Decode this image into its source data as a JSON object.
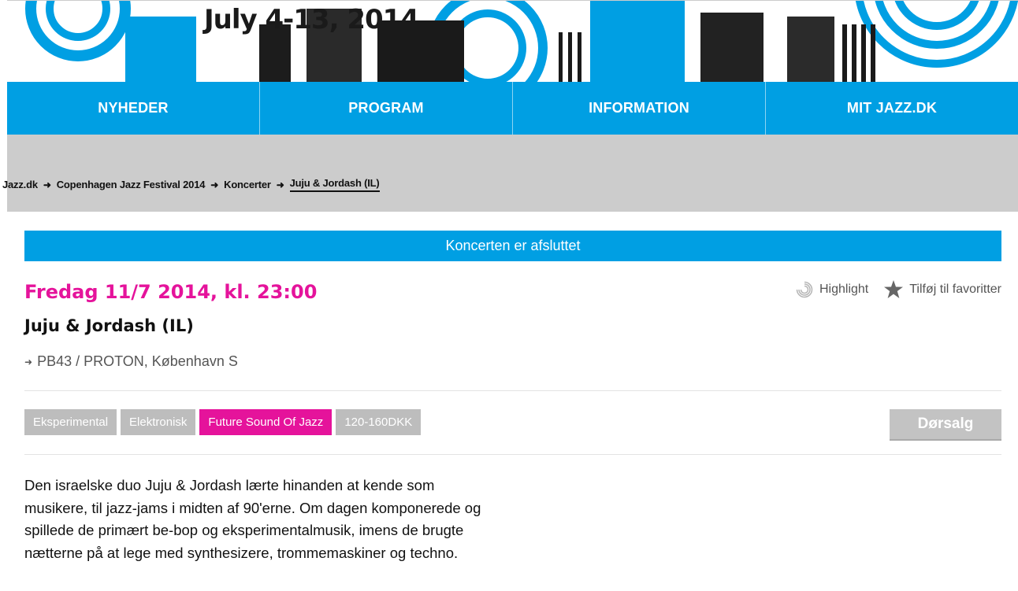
{
  "banner": {
    "title": "July 4-13, 2014"
  },
  "nav": {
    "items": [
      "NYHEDER",
      "PROGRAM",
      "INFORMATION",
      "MIT JAZZ.DK"
    ]
  },
  "breadcrumb": {
    "items": [
      "Jazz.dk",
      "Copenhagen Jazz Festival 2014",
      "Koncerter",
      "Juju & Jordash (IL)"
    ],
    "separator": "➜"
  },
  "status": {
    "text": "Koncerten er afsluttet"
  },
  "event": {
    "date": "Fredag 11/7 2014, kl. 23:00",
    "title": "Juju & Jordash (IL)",
    "venue": "PB43 / PROTON, København S",
    "venue_arrow": "➜",
    "tags": [
      "Eksperimental",
      "Elektronisk",
      "Future Sound Of Jazz",
      "120-160DKK"
    ],
    "buy_label": "Dørsalg",
    "description": "Den israelske duo Juju & Jordash lærte hinanden at kende som musikere, til jazz-jams i midten af 90'erne. Om dagen komponerede og spillede de primært be-bop og eksperimentalmusik, imens de brugte nætterne på at lege med synthesizere, trommemaskiner og techno."
  },
  "actions": {
    "highlight_label": "Highlight",
    "favorite_label": "Tilføj til favoritter"
  },
  "colors": {
    "brand_blue": "#009fe3",
    "accent_magenta": "#e5139b",
    "tag_gray": "#bdbdbd",
    "band_gray": "#cccccc"
  },
  "icons": {
    "highlight": "highlight-swirl-icon",
    "favorite": "star-icon",
    "arrow": "arrow-right-icon"
  }
}
